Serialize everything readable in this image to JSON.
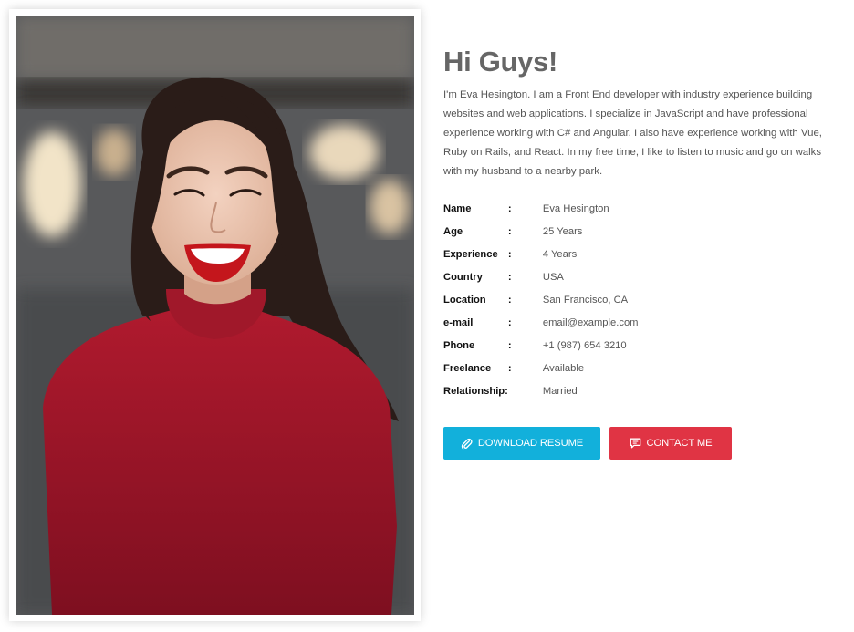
{
  "heading": "Hi Guys!",
  "bio": "I'm Eva Hesington. I am a Front End developer with industry experience building websites and web applications. I specialize in JavaScript and have professional experience working with C# and Angular. I also have experience working with Vue, Ruby on Rails, and React. In my free time, I like to listen to music and go on walks with my husband to a nearby park.",
  "info": [
    {
      "label": "Name",
      "colon": ":",
      "value": "Eva Hesington"
    },
    {
      "label": "Age",
      "colon": ":",
      "value": "25 Years"
    },
    {
      "label": "Experience",
      "colon": ":",
      "value": "4 Years"
    },
    {
      "label": "Country",
      "colon": ":",
      "value": "USA"
    },
    {
      "label": "Location",
      "colon": ":",
      "value": "San Francisco, CA"
    },
    {
      "label": "e-mail",
      "colon": ":",
      "value": "email@example.com"
    },
    {
      "label": "Phone",
      "colon": ":",
      "value": "+1 (987) 654 3210"
    },
    {
      "label": "Freelance",
      "colon": ":",
      "value": "Available"
    },
    {
      "label": "Relationship:",
      "colon": "",
      "value": "Married"
    }
  ],
  "buttons": {
    "download_label": "DOWNLOAD RESUME",
    "download_icon": "paperclip-icon",
    "contact_label": "CONTACT ME",
    "contact_icon": "message-icon"
  },
  "colors": {
    "download_button": "#12b0db",
    "contact_button": "#e03444",
    "heading": "#666666"
  }
}
